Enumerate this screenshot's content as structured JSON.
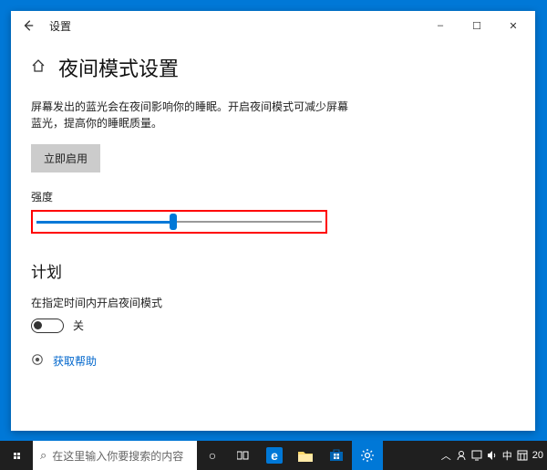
{
  "window": {
    "title": "设置",
    "minimize": "–",
    "maximize": "☐",
    "close": "✕"
  },
  "page": {
    "title": "夜间模式设置",
    "description": "屏幕发出的蓝光会在夜间影响你的睡眠。开启夜间模式可减少屏幕蓝光，提高你的睡眠质量。",
    "enable_button": "立即启用",
    "slider": {
      "label": "强度",
      "value": 48,
      "min": 0,
      "max": 100
    },
    "plan": {
      "heading": "计划",
      "description": "在指定时间内开启夜间模式",
      "toggle_state": "off",
      "toggle_label": "关"
    },
    "help_link": "获取帮助"
  },
  "taskbar": {
    "search_placeholder": "在这里输入你要搜索的内容",
    "systray": {
      "ime": "中",
      "clock_text": "20"
    }
  }
}
